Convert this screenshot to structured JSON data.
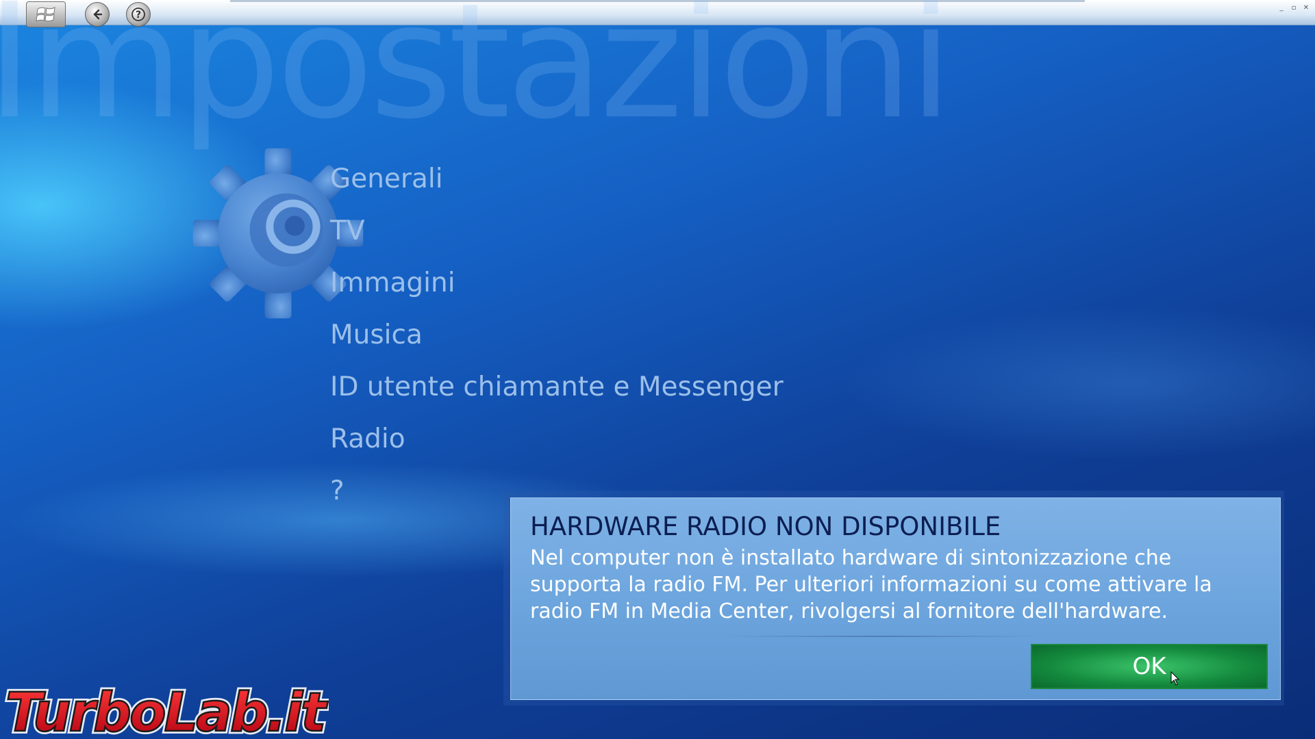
{
  "window": {
    "controls": [
      "_",
      "▫",
      "✕"
    ]
  },
  "icons": {
    "start": "windows-logo-icon",
    "back": "back-arrow-icon",
    "help": "help-icon",
    "settings": "gear-icon",
    "cursor": "mouse-pointer-icon"
  },
  "background_title": "Impostazioni",
  "menu": {
    "items": [
      {
        "label": "Generali"
      },
      {
        "label": "TV"
      },
      {
        "label": "Immagini"
      },
      {
        "label": "Musica"
      },
      {
        "label": "ID utente chiamante e Messenger"
      },
      {
        "label": "Radio"
      },
      {
        "label": "?"
      }
    ]
  },
  "dialog": {
    "title": "HARDWARE RADIO NON DISPONIBILE",
    "message": "Nel computer non è installato hardware di sintonizzazione che supporta la radio FM. Per ulteriori informazioni su come attivare la radio FM in Media Center, rivolgersi al fornitore dell'hardware.",
    "ok_label": "OK"
  },
  "watermark": {
    "brand": "TurboLab.it"
  },
  "colors": {
    "menu_text": "#9cc0ea",
    "dialog_title": "#0b1e52",
    "ok_button": "#148a3e",
    "watermark_red": "#d9121f"
  }
}
